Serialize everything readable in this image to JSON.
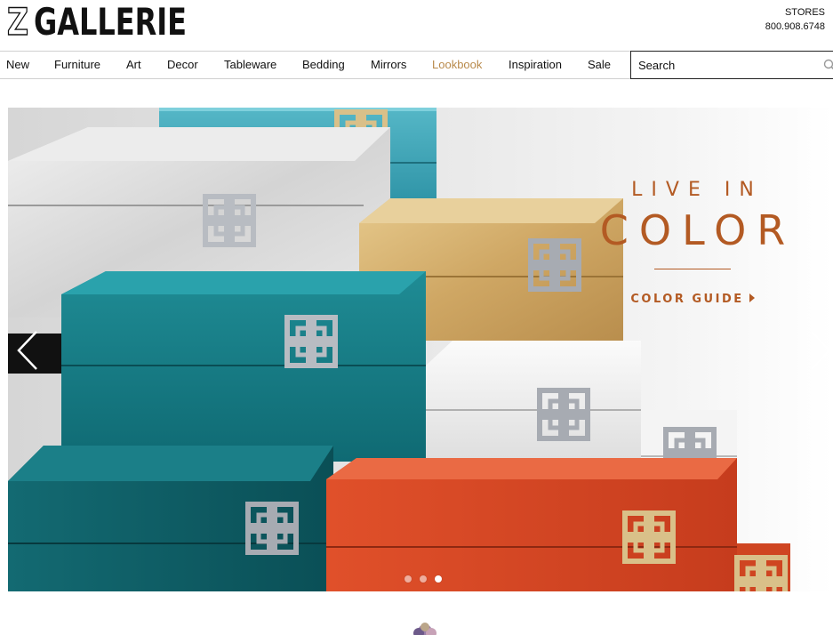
{
  "brand": {
    "logo_text": "ZGALLERIE"
  },
  "header": {
    "stores_label": "STORES",
    "phone": "800.908.6748"
  },
  "nav": {
    "items": [
      {
        "label": "New"
      },
      {
        "label": "Furniture"
      },
      {
        "label": "Art"
      },
      {
        "label": "Decor"
      },
      {
        "label": "Tableware"
      },
      {
        "label": "Bedding"
      },
      {
        "label": "Mirrors"
      },
      {
        "label": "Lookbook",
        "active": true
      },
      {
        "label": "Inspiration"
      },
      {
        "label": "Sale"
      }
    ],
    "active_color": "#b98a4b"
  },
  "search": {
    "placeholder": "Search",
    "icon": "search-icon"
  },
  "hero": {
    "headline_small": "LIVE IN",
    "headline_big": "COLOR",
    "cta_label": "COLOR GUIDE",
    "accent_color": "#b35a23",
    "prev_icon": "chevron-left-icon",
    "next_icon": "chevron-right-icon",
    "slides_total": 3,
    "active_slide": 3
  }
}
